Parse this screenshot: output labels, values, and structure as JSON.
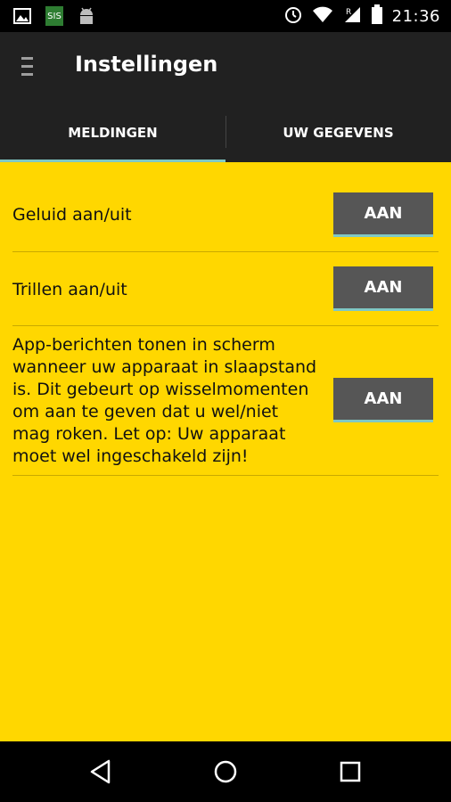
{
  "status_bar": {
    "time": "21:36",
    "icons": [
      "image-icon",
      "app-logo-icon",
      "android-icon",
      "alarm-icon",
      "wifi-icon",
      "signal-roaming-icon",
      "battery-icon"
    ]
  },
  "action_bar": {
    "title": "Instellingen"
  },
  "tabs": [
    {
      "label": "MELDINGEN",
      "active": true
    },
    {
      "label": "UW GEGEVENS",
      "active": false
    }
  ],
  "settings": [
    {
      "label": "Geluid aan/uit",
      "toggle": "AAN"
    },
    {
      "label": "Trillen aan/uit",
      "toggle": "AAN"
    },
    {
      "label": "App-berichten tonen in scherm wanneer uw apparaat in slaapstand is. Dit gebeurt op wisselmomenten om aan te geven dat u wel/niet mag roken. Let op: Uw apparaat moet wel ingeschakeld zijn!",
      "toggle": "AAN"
    }
  ],
  "colors": {
    "content_bg": "#ffd700",
    "toolbar_bg": "#212121",
    "toggle_bg": "#565656",
    "accent": "#7fc8c5"
  },
  "nav_bar": {
    "icons": [
      "back-icon",
      "home-icon",
      "recents-icon"
    ]
  }
}
